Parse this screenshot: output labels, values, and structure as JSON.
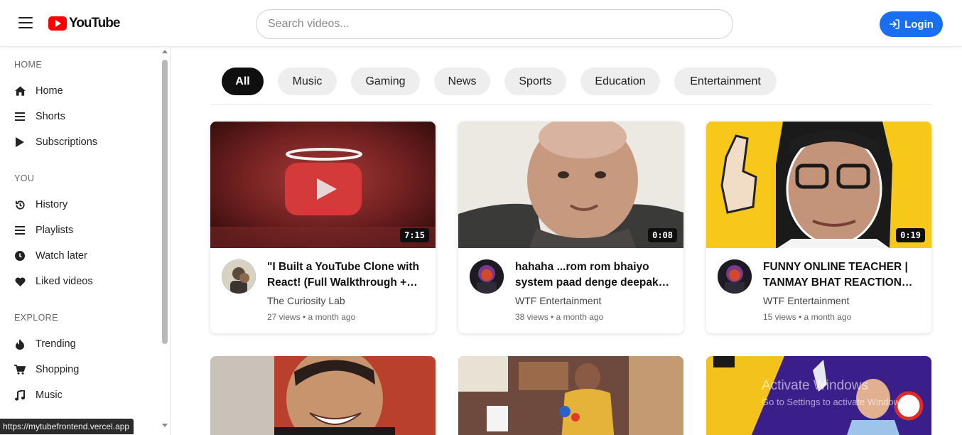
{
  "header": {
    "logo_text": "YouTube",
    "search_placeholder": "Search videos...",
    "login_label": "Login"
  },
  "sidebar": {
    "sections": [
      {
        "title": "HOME",
        "items": [
          {
            "label": "Home",
            "icon": "home-icon"
          },
          {
            "label": "Shorts",
            "icon": "shorts-icon"
          },
          {
            "label": "Subscriptions",
            "icon": "subscriptions-icon"
          }
        ]
      },
      {
        "title": "YOU",
        "items": [
          {
            "label": "History",
            "icon": "history-icon"
          },
          {
            "label": "Playlists",
            "icon": "playlists-icon"
          },
          {
            "label": "Watch later",
            "icon": "clock-icon"
          },
          {
            "label": "Liked videos",
            "icon": "heart-icon"
          }
        ]
      },
      {
        "title": "EXPLORE",
        "items": [
          {
            "label": "Trending",
            "icon": "fire-icon"
          },
          {
            "label": "Shopping",
            "icon": "cart-icon"
          },
          {
            "label": "Music",
            "icon": "music-note-icon"
          }
        ]
      }
    ]
  },
  "status_url": "https://mytubefrontend.vercel.app",
  "chips": [
    "All",
    "Music",
    "Gaming",
    "News",
    "Sports",
    "Education",
    "Entertainment"
  ],
  "active_chip": "All",
  "videos": [
    {
      "title": "\"I Built a YouTube Clone with React! (Full Walkthrough + Live Demo)",
      "channel": "The Curiosity Lab",
      "meta": "27 views • a month ago",
      "duration": "7:15"
    },
    {
      "title": "hahaha ...rom rom bhaiyo system paad denge deepak kalal",
      "channel": "WTF Entertainment",
      "meta": "38 views • a month ago",
      "duration": "0:08"
    },
    {
      "title": "FUNNY ONLINE TEACHER | TANMAY BHAT REACTION VIDEO",
      "channel": "WTF Entertainment",
      "meta": "15 views • a month ago",
      "duration": "0:19"
    }
  ],
  "watermark": {
    "line1": "Activate Windows",
    "line2": "Go to Settings to activate Windows."
  },
  "colors": {
    "accent": "#1a6ff0",
    "brand_red": "#ff0000",
    "chip_bg": "#eeeeee",
    "chip_active_bg": "#0f0f0f"
  }
}
